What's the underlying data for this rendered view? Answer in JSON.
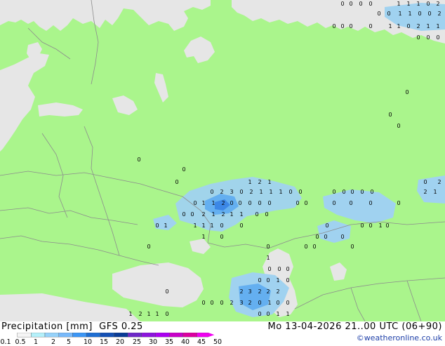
{
  "map": {
    "title": "Precipitation [mm]",
    "model": "GFS 0.25",
    "valid_time": "Mo 13-04-2026 21..00 UTC (06+90)",
    "credit": "©weatheronline.co.uk",
    "colors": {
      "land": "#aaf58c",
      "sea_outside": "#e6e6e6",
      "border": "#8c8c8c",
      "precip_light": "#a0d2f0",
      "precip_mid": "#64aff0",
      "precip_heavy": "#3c87e6"
    }
  },
  "legend": {
    "labels": [
      "0.1",
      "0.5",
      "1",
      "2",
      "5",
      "10",
      "15",
      "20",
      "25",
      "30",
      "35",
      "40",
      "45",
      "50"
    ],
    "colors": [
      "#f5f5f5",
      "#b4f0fa",
      "#96d2fa",
      "#78b9fa",
      "#3c96f5",
      "#1e6ed2",
      "#1450b4",
      "#0a3c96",
      "#6e28c8",
      "#8c14dc",
      "#aa00f0",
      "#c800c8",
      "#dc00a0",
      "#f000f0"
    ]
  },
  "grid_values": [
    {
      "t": "0"
    },
    {
      "t": "0"
    },
    {
      "t": "0"
    },
    {
      "t": "0"
    },
    {
      "t": "1"
    },
    {
      "t": "1"
    },
    {
      "t": "1"
    },
    {
      "t": "0"
    },
    {
      "t": "2"
    },
    {
      "t": "0"
    },
    {
      "t": "0"
    },
    {
      "t": "1"
    },
    {
      "t": "1"
    },
    {
      "t": "0"
    },
    {
      "t": "0"
    },
    {
      "t": "2"
    },
    {
      "t": "0"
    },
    {
      "t": "0"
    },
    {
      "t": "0"
    },
    {
      "t": "0"
    },
    {
      "t": "1"
    },
    {
      "t": "1"
    },
    {
      "t": "0"
    },
    {
      "t": "2"
    },
    {
      "t": "1"
    },
    {
      "t": "1"
    },
    {
      "t": "0"
    },
    {
      "t": "0"
    },
    {
      "t": "0"
    },
    {
      "t": "0"
    },
    {
      "t": "0"
    },
    {
      "t": "0"
    },
    {
      "t": "0"
    },
    {
      "t": "0"
    },
    {
      "t": "0"
    },
    {
      "t": "1"
    },
    {
      "t": "2"
    },
    {
      "t": "1"
    },
    {
      "t": "0"
    },
    {
      "t": "2"
    },
    {
      "t": "3"
    },
    {
      "t": "0"
    },
    {
      "t": "2"
    },
    {
      "t": "1"
    },
    {
      "t": "1"
    },
    {
      "t": "1"
    },
    {
      "t": "0"
    },
    {
      "t": "0"
    },
    {
      "t": "0"
    },
    {
      "t": "0"
    },
    {
      "t": "0"
    },
    {
      "t": "0"
    },
    {
      "t": "0"
    },
    {
      "t": "0"
    },
    {
      "t": "0"
    },
    {
      "t": "1"
    },
    {
      "t": "1"
    },
    {
      "t": "2"
    },
    {
      "t": "0"
    },
    {
      "t": "0"
    },
    {
      "t": "0"
    },
    {
      "t": "0"
    },
    {
      "t": "0"
    },
    {
      "t": "0"
    },
    {
      "t": "0"
    },
    {
      "t": "0"
    },
    {
      "t": "0"
    },
    {
      "t": "0"
    },
    {
      "t": "0"
    },
    {
      "t": "0"
    },
    {
      "t": "0"
    },
    {
      "t": "2"
    },
    {
      "t": "1"
    },
    {
      "t": "2"
    },
    {
      "t": "1"
    },
    {
      "t": "1"
    },
    {
      "t": "0"
    },
    {
      "t": "0"
    },
    {
      "t": "0"
    },
    {
      "t": "1"
    },
    {
      "t": "1"
    },
    {
      "t": "1"
    },
    {
      "t": "1"
    },
    {
      "t": "0"
    },
    {
      "t": "0"
    },
    {
      "t": "0"
    },
    {
      "t": "0"
    },
    {
      "t": "1"
    },
    {
      "t": "0"
    },
    {
      "t": "0"
    },
    {
      "t": "0"
    },
    {
      "t": "0"
    },
    {
      "t": "0"
    },
    {
      "t": "1"
    },
    {
      "t": "0"
    },
    {
      "t": "0"
    },
    {
      "t": "0"
    },
    {
      "t": "0"
    },
    {
      "t": "0"
    },
    {
      "t": "0"
    },
    {
      "t": "1"
    },
    {
      "t": "0"
    },
    {
      "t": "0"
    },
    {
      "t": "0"
    },
    {
      "t": "0"
    },
    {
      "t": "0"
    },
    {
      "t": "1"
    },
    {
      "t": "0"
    },
    {
      "t": "2"
    },
    {
      "t": "3"
    },
    {
      "t": "2"
    },
    {
      "t": "2"
    },
    {
      "t": "2"
    },
    {
      "t": "0"
    },
    {
      "t": "0"
    },
    {
      "t": "0"
    },
    {
      "t": "0"
    },
    {
      "t": "2"
    },
    {
      "t": "3"
    },
    {
      "t": "2"
    },
    {
      "t": "0"
    },
    {
      "t": "1"
    },
    {
      "t": "0"
    },
    {
      "t": "0"
    },
    {
      "t": "1"
    },
    {
      "t": "2"
    },
    {
      "t": "1"
    },
    {
      "t": "1"
    },
    {
      "t": "0"
    },
    {
      "t": "0"
    },
    {
      "t": "0"
    },
    {
      "t": "1"
    },
    {
      "t": "1"
    },
    {
      "t": "2"
    },
    {
      "t": "1"
    },
    {
      "t": "2"
    },
    {
      "t": "0"
    },
    {
      "t": "0"
    },
    {
      "t": "0"
    },
    {
      "t": "1"
    },
    {
      "t": "1"
    },
    {
      "t": "0"
    }
  ]
}
